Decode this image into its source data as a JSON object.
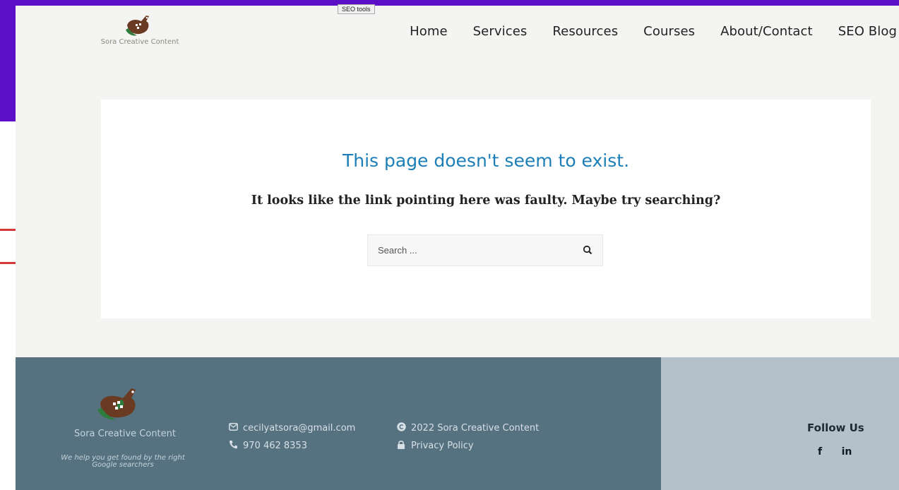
{
  "header": {
    "logo_text": "Sora Creative Content",
    "tooltip": "SEO tools",
    "nav": [
      "Home",
      "Services",
      "Resources",
      "Courses",
      "About/Contact",
      "SEO Blog"
    ]
  },
  "main": {
    "title": "This page doesn't seem to exist.",
    "subtitle": "It looks like the link pointing here was faulty. Maybe try searching?",
    "search_placeholder": "Search ..."
  },
  "footer": {
    "brand": "Sora Creative Content",
    "tagline": "We help you get found by the right Google searchers",
    "email": "cecilyatsora@gmail.com",
    "phone": "970 462 8353",
    "copyright": "2022 Sora Creative Content",
    "privacy": "Privacy Policy",
    "follow_title": "Follow Us",
    "socials": [
      "f",
      "in"
    ]
  },
  "colors": {
    "purple": "#5b10c7",
    "title_blue": "#1d7fb7",
    "footer_dark": "#56717f",
    "footer_light": "#b4c1ca"
  }
}
